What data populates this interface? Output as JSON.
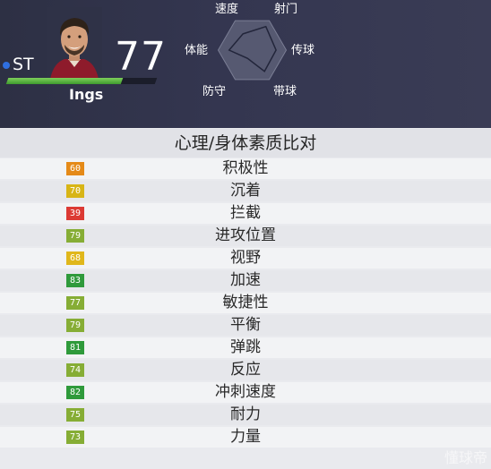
{
  "player": {
    "position": "ST",
    "overall": "77",
    "name": "Ings",
    "rating_fraction": 0.77
  },
  "radar": {
    "labels": {
      "speed": "速度",
      "shooting": "射门",
      "passing": "传球",
      "dribbling": "带球",
      "defending": "防守",
      "physical": "体能"
    },
    "values": [
      0.55,
      0.8,
      0.7,
      0.72,
      0.28,
      0.68
    ]
  },
  "section": {
    "title": "心理/身体素质比对"
  },
  "attributes": [
    {
      "name": "积极性",
      "value": "60",
      "color": "#e58a18"
    },
    {
      "name": "沉着",
      "value": "70",
      "color": "#d8b516"
    },
    {
      "name": "拦截",
      "value": "39",
      "color": "#dc3a34"
    },
    {
      "name": "进攻位置",
      "value": "79",
      "color": "#86ad35"
    },
    {
      "name": "视野",
      "value": "68",
      "color": "#e0b71b"
    },
    {
      "name": "加速",
      "value": "83",
      "color": "#2f9a3b"
    },
    {
      "name": "敏捷性",
      "value": "77",
      "color": "#86ad35"
    },
    {
      "name": "平衡",
      "value": "79",
      "color": "#86ad35"
    },
    {
      "name": "弹跳",
      "value": "81",
      "color": "#2f9a3b"
    },
    {
      "name": "反应",
      "value": "74",
      "color": "#86ad35"
    },
    {
      "name": "冲刺速度",
      "value": "82",
      "color": "#2f9a3b"
    },
    {
      "name": "耐力",
      "value": "75",
      "color": "#86ad35"
    },
    {
      "name": "力量",
      "value": "73",
      "color": "#86ad35"
    }
  ],
  "watermark": "懂球帝"
}
